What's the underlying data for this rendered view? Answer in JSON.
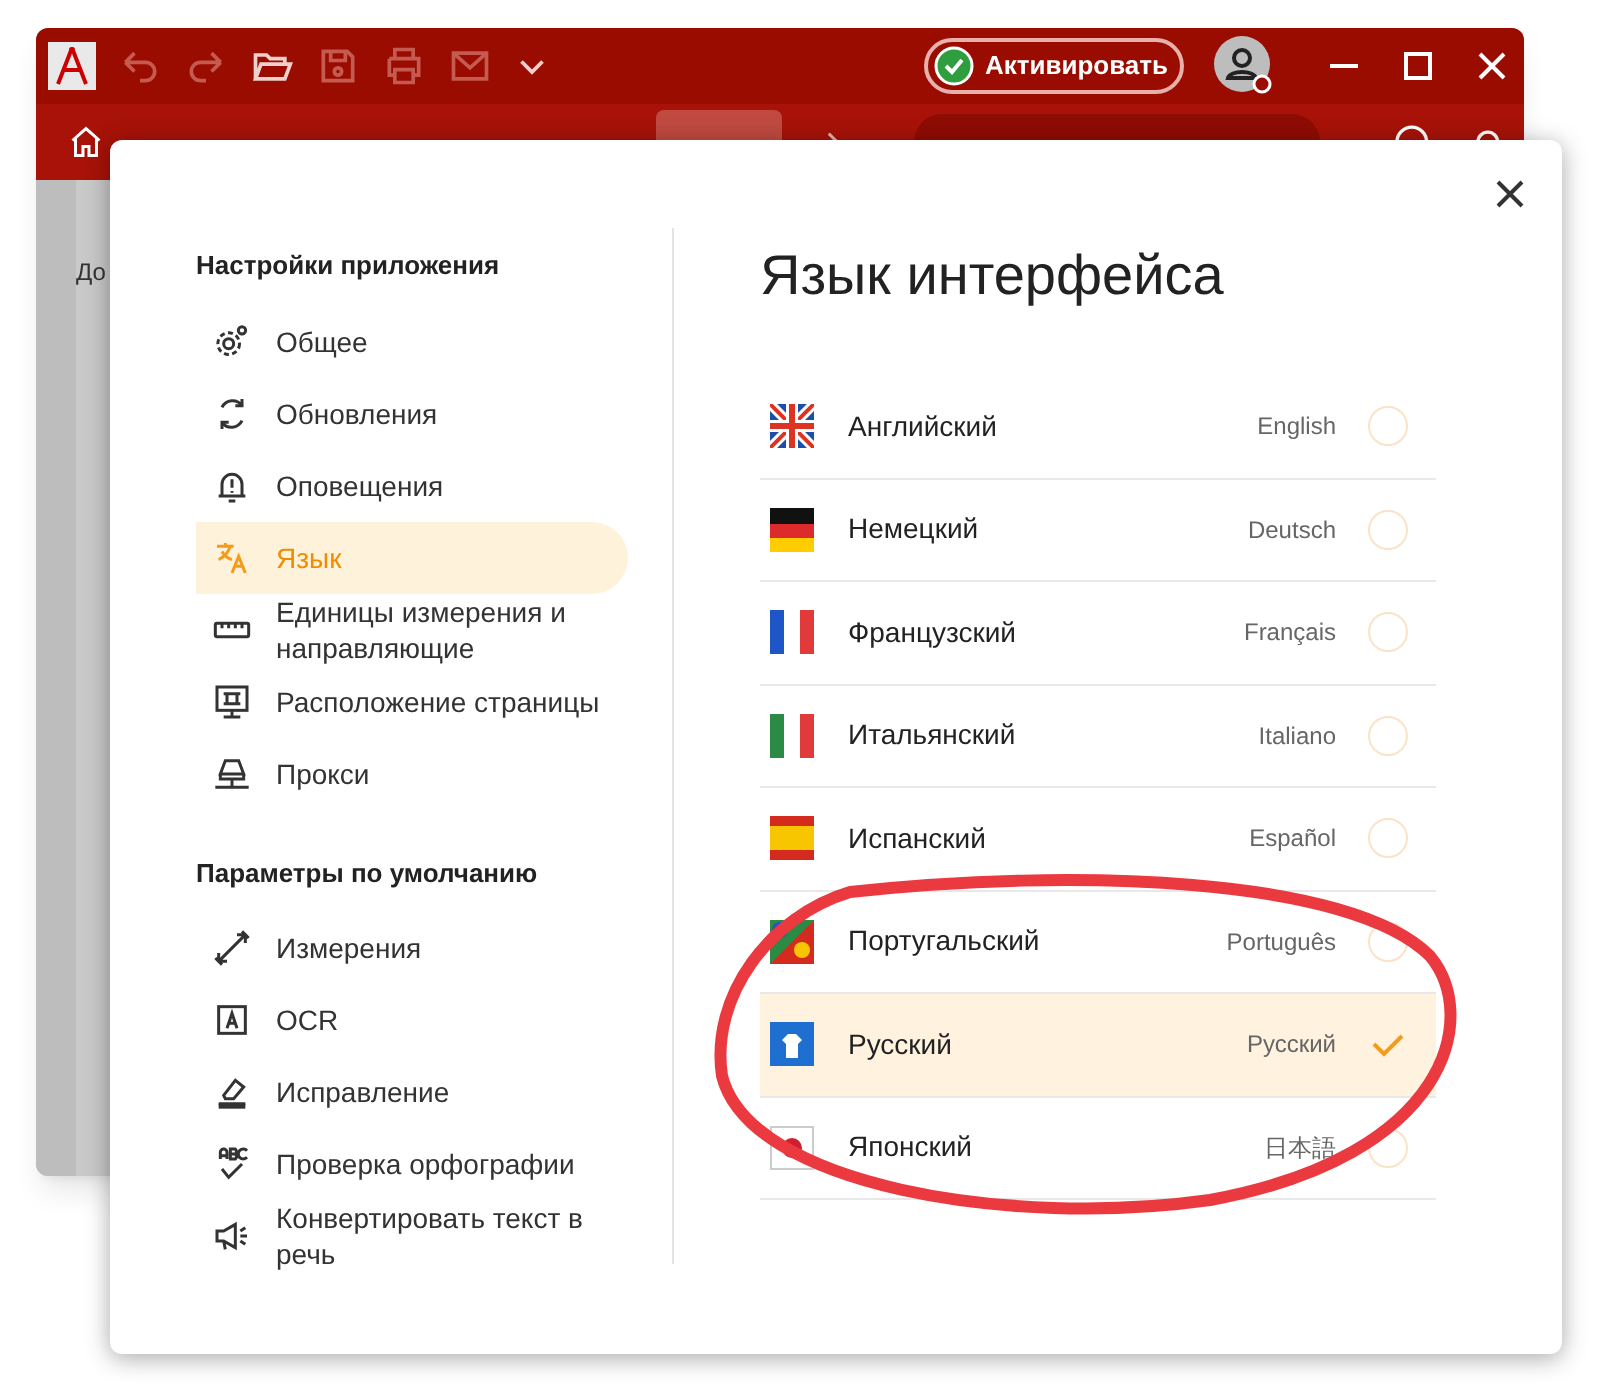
{
  "app": {
    "activate_button": "Активировать",
    "body_text": "До"
  },
  "dialog": {
    "sections": [
      {
        "title": "Настройки приложения",
        "items": [
          {
            "label": "Общее",
            "kind": "gear",
            "selected": false
          },
          {
            "label": "Обновления",
            "kind": "sync",
            "selected": false
          },
          {
            "label": "Оповещения",
            "kind": "bell",
            "selected": false
          },
          {
            "label": "Язык",
            "kind": "translate",
            "selected": true
          },
          {
            "label": "Единицы измерения и направляющие",
            "kind": "ruler",
            "selected": false
          },
          {
            "label": "Расположение страницы",
            "kind": "layout",
            "selected": false
          },
          {
            "label": "Прокси",
            "kind": "proxy",
            "selected": false
          }
        ]
      },
      {
        "title": "Параметры по умолчанию",
        "items": [
          {
            "label": "Измерения",
            "kind": "measure",
            "selected": false
          },
          {
            "label": "OCR",
            "kind": "ocr",
            "selected": false
          },
          {
            "label": "Исправление",
            "kind": "eraser",
            "selected": false
          },
          {
            "label": "Проверка орфографии",
            "kind": "spell",
            "selected": false
          },
          {
            "label": "Конвертировать текст в речь",
            "kind": "speaker",
            "selected": false
          }
        ]
      }
    ],
    "title": "Язык интерфейса",
    "languages": [
      {
        "name": "Английский",
        "native": "English",
        "kind": "uk",
        "selected": false
      },
      {
        "name": "Немецкий",
        "native": "Deutsch",
        "kind": "de",
        "selected": false
      },
      {
        "name": "Французский",
        "native": "Français",
        "kind": "fr",
        "selected": false
      },
      {
        "name": "Итальянский",
        "native": "Italiano",
        "kind": "it",
        "selected": false
      },
      {
        "name": "Испанский",
        "native": "Español",
        "kind": "es",
        "selected": false
      },
      {
        "name": "Португальский",
        "native": "Português",
        "kind": "pt",
        "selected": false
      },
      {
        "name": "Русский",
        "native": "Русский",
        "kind": "ru",
        "selected": true
      },
      {
        "name": "Японский",
        "native": "日本語",
        "kind": "jp",
        "selected": false
      }
    ]
  }
}
